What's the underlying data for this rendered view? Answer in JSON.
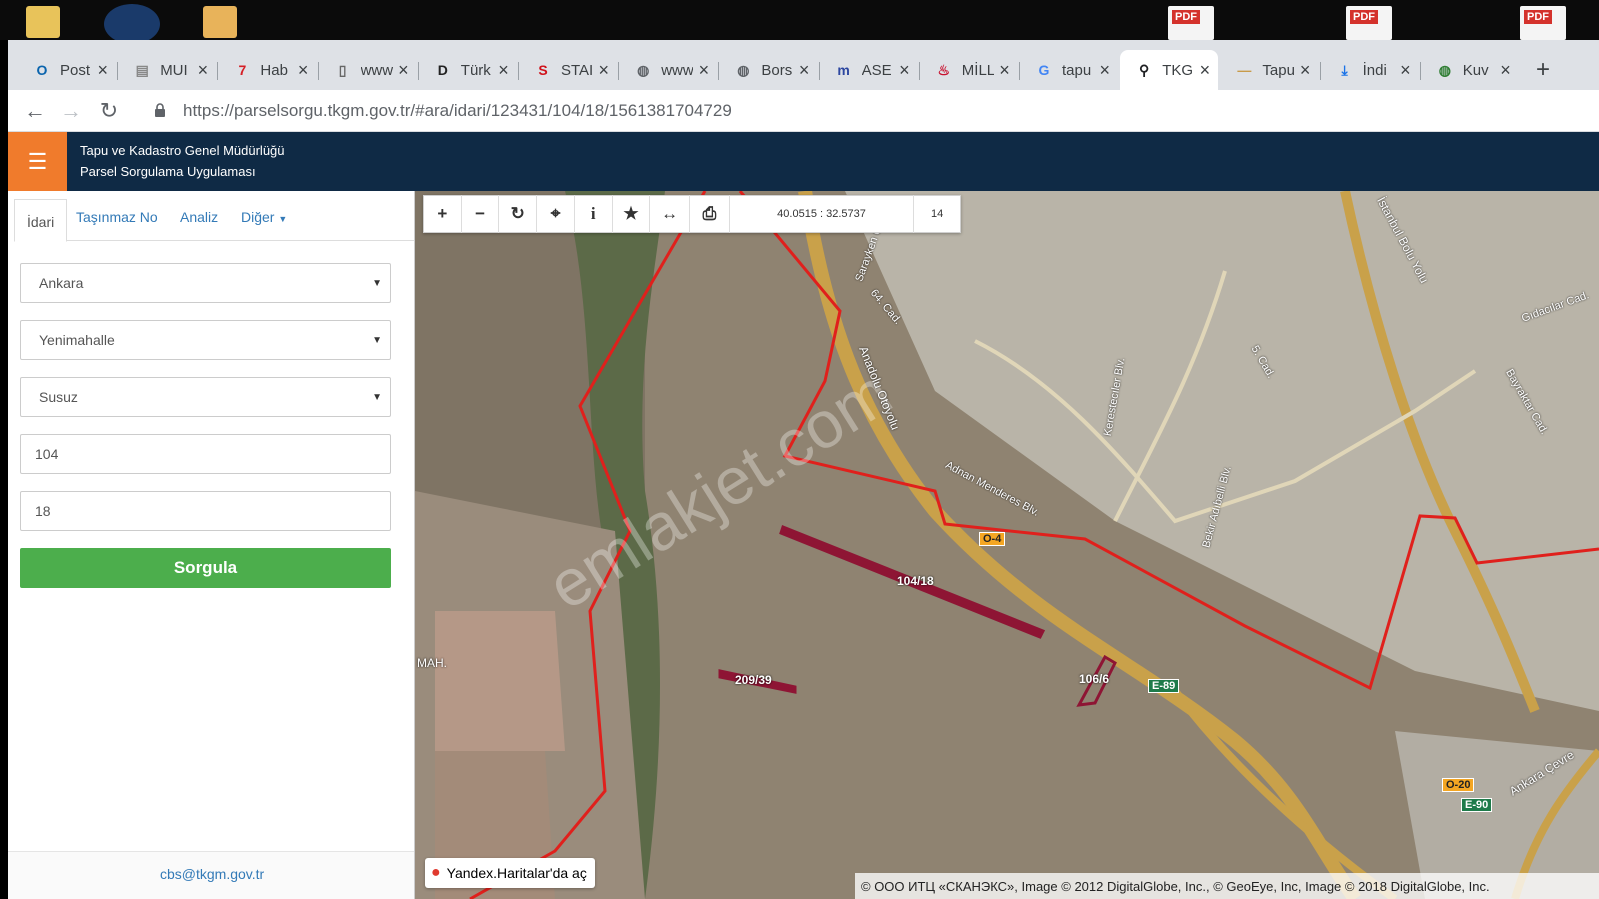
{
  "tabs": [
    {
      "label": "Post",
      "icon": "outlook-icon",
      "color": "#0a64ad"
    },
    {
      "label": "MUI",
      "icon": "document-icon",
      "color": "#888888"
    },
    {
      "label": "Hab",
      "icon": "news-icon",
      "color": "#d51f26"
    },
    {
      "label": "www",
      "icon": "page-icon",
      "color": "#666666"
    },
    {
      "label": "Türk",
      "icon": "d-icon",
      "color": "#222222"
    },
    {
      "label": "STAI",
      "icon": "s-icon",
      "color": "#d0121b"
    },
    {
      "label": "www",
      "icon": "globe-icon",
      "color": "#5f6368"
    },
    {
      "label": "Bors",
      "icon": "globe-icon",
      "color": "#5f6368"
    },
    {
      "label": "ASE",
      "icon": "m-icon",
      "color": "#2d47a0"
    },
    {
      "label": "MİLL",
      "icon": "flame-icon",
      "color": "#c8102e"
    },
    {
      "label": "tapu",
      "icon": "google-icon",
      "color": "#4285f4"
    },
    {
      "label": "TKG",
      "icon": "map-pin-icon",
      "color": "#202124"
    },
    {
      "label": "Tapu",
      "icon": "line-icon",
      "color": "#c89b4a"
    },
    {
      "label": "İndi",
      "icon": "download-icon",
      "color": "#1a73e8"
    },
    {
      "label": "Kuv",
      "icon": "globe-green-icon",
      "color": "#2e7d32"
    }
  ],
  "browser": {
    "url": "https://parselsorgu.tkgm.gov.tr/#ara/idari/123431/104/18/1561381704729"
  },
  "app": {
    "title_line1": "Tapu ve Kadastro Genel Müdürlüğü",
    "title_line2": "Parsel Sorgulama Uygulaması",
    "accent": "#f07b2c",
    "header_bg": "#0f2a45"
  },
  "sidebar": {
    "tabs": [
      "İdari",
      "Taşınmaz No",
      "Analiz",
      "Diğer"
    ],
    "province": "Ankara",
    "district": "Yenimahalle",
    "neighborhood": "Susuz",
    "block": "104",
    "parcel": "18",
    "button": "Sorgula",
    "footer_email": "cbs@tkgm.gov.tr"
  },
  "map": {
    "coords": "40.0515 : 32.5737",
    "zoom": "14",
    "yandex_link": "Yandex.Haritalar'da aç",
    "attribution": "© ООО ИТЦ «СКАНЭКС», Image © 2012 DigitalGlobe, Inc., © GeoEye, Inc, Image © 2018 DigitalGlobe, Inc.",
    "watermark": "emlakjet.com",
    "parcel_labels": [
      "104/18",
      "209/39",
      "106/6"
    ],
    "road_labels": [
      "O-4",
      "E-89",
      "O-20",
      "E-90"
    ],
    "street_labels": [
      "İstanbul Bolu Yolu",
      "Anadolu Otoyolu",
      "Adnan Menderes Blv.",
      "Kerestecıler Blv.",
      "Bekir Adıbelli Blv.",
      "Gıdacılar Cad.",
      "Bayraktar Cad.",
      "Sarayken Cad.",
      "64. Cad.",
      "5. Cad.",
      "Ankara Çevre",
      "MAH."
    ]
  }
}
